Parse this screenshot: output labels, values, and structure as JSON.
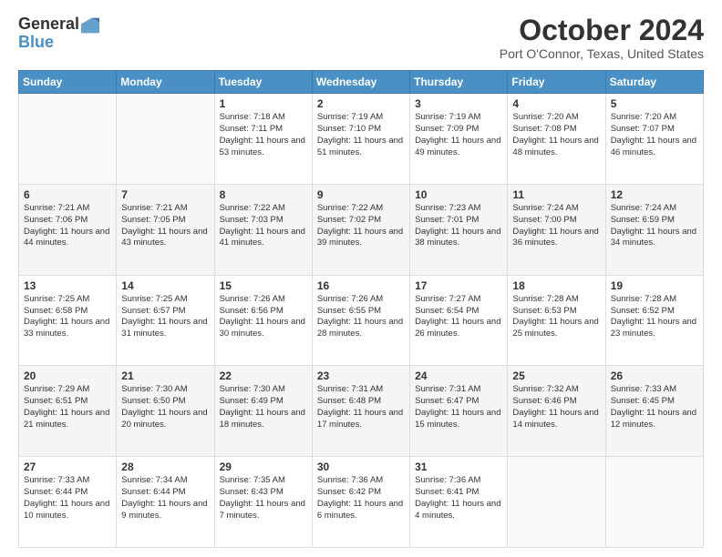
{
  "header": {
    "logo_line1": "General",
    "logo_line2": "Blue",
    "month_title": "October 2024",
    "location": "Port O'Connor, Texas, United States"
  },
  "weekdays": [
    "Sunday",
    "Monday",
    "Tuesday",
    "Wednesday",
    "Thursday",
    "Friday",
    "Saturday"
  ],
  "weeks": [
    [
      null,
      null,
      {
        "day": 1,
        "sunrise": "7:18 AM",
        "sunset": "7:11 PM",
        "daylight": "11 hours and 53 minutes."
      },
      {
        "day": 2,
        "sunrise": "7:19 AM",
        "sunset": "7:10 PM",
        "daylight": "11 hours and 51 minutes."
      },
      {
        "day": 3,
        "sunrise": "7:19 AM",
        "sunset": "7:09 PM",
        "daylight": "11 hours and 49 minutes."
      },
      {
        "day": 4,
        "sunrise": "7:20 AM",
        "sunset": "7:08 PM",
        "daylight": "11 hours and 48 minutes."
      },
      {
        "day": 5,
        "sunrise": "7:20 AM",
        "sunset": "7:07 PM",
        "daylight": "11 hours and 46 minutes."
      }
    ],
    [
      {
        "day": 6,
        "sunrise": "7:21 AM",
        "sunset": "7:06 PM",
        "daylight": "11 hours and 44 minutes."
      },
      {
        "day": 7,
        "sunrise": "7:21 AM",
        "sunset": "7:05 PM",
        "daylight": "11 hours and 43 minutes."
      },
      {
        "day": 8,
        "sunrise": "7:22 AM",
        "sunset": "7:03 PM",
        "daylight": "11 hours and 41 minutes."
      },
      {
        "day": 9,
        "sunrise": "7:22 AM",
        "sunset": "7:02 PM",
        "daylight": "11 hours and 39 minutes."
      },
      {
        "day": 10,
        "sunrise": "7:23 AM",
        "sunset": "7:01 PM",
        "daylight": "11 hours and 38 minutes."
      },
      {
        "day": 11,
        "sunrise": "7:24 AM",
        "sunset": "7:00 PM",
        "daylight": "11 hours and 36 minutes."
      },
      {
        "day": 12,
        "sunrise": "7:24 AM",
        "sunset": "6:59 PM",
        "daylight": "11 hours and 34 minutes."
      }
    ],
    [
      {
        "day": 13,
        "sunrise": "7:25 AM",
        "sunset": "6:58 PM",
        "daylight": "11 hours and 33 minutes."
      },
      {
        "day": 14,
        "sunrise": "7:25 AM",
        "sunset": "6:57 PM",
        "daylight": "11 hours and 31 minutes."
      },
      {
        "day": 15,
        "sunrise": "7:26 AM",
        "sunset": "6:56 PM",
        "daylight": "11 hours and 30 minutes."
      },
      {
        "day": 16,
        "sunrise": "7:26 AM",
        "sunset": "6:55 PM",
        "daylight": "11 hours and 28 minutes."
      },
      {
        "day": 17,
        "sunrise": "7:27 AM",
        "sunset": "6:54 PM",
        "daylight": "11 hours and 26 minutes."
      },
      {
        "day": 18,
        "sunrise": "7:28 AM",
        "sunset": "6:53 PM",
        "daylight": "11 hours and 25 minutes."
      },
      {
        "day": 19,
        "sunrise": "7:28 AM",
        "sunset": "6:52 PM",
        "daylight": "11 hours and 23 minutes."
      }
    ],
    [
      {
        "day": 20,
        "sunrise": "7:29 AM",
        "sunset": "6:51 PM",
        "daylight": "11 hours and 21 minutes."
      },
      {
        "day": 21,
        "sunrise": "7:30 AM",
        "sunset": "6:50 PM",
        "daylight": "11 hours and 20 minutes."
      },
      {
        "day": 22,
        "sunrise": "7:30 AM",
        "sunset": "6:49 PM",
        "daylight": "11 hours and 18 minutes."
      },
      {
        "day": 23,
        "sunrise": "7:31 AM",
        "sunset": "6:48 PM",
        "daylight": "11 hours and 17 minutes."
      },
      {
        "day": 24,
        "sunrise": "7:31 AM",
        "sunset": "6:47 PM",
        "daylight": "11 hours and 15 minutes."
      },
      {
        "day": 25,
        "sunrise": "7:32 AM",
        "sunset": "6:46 PM",
        "daylight": "11 hours and 14 minutes."
      },
      {
        "day": 26,
        "sunrise": "7:33 AM",
        "sunset": "6:45 PM",
        "daylight": "11 hours and 12 minutes."
      }
    ],
    [
      {
        "day": 27,
        "sunrise": "7:33 AM",
        "sunset": "6:44 PM",
        "daylight": "11 hours and 10 minutes."
      },
      {
        "day": 28,
        "sunrise": "7:34 AM",
        "sunset": "6:44 PM",
        "daylight": "11 hours and 9 minutes."
      },
      {
        "day": 29,
        "sunrise": "7:35 AM",
        "sunset": "6:43 PM",
        "daylight": "11 hours and 7 minutes."
      },
      {
        "day": 30,
        "sunrise": "7:36 AM",
        "sunset": "6:42 PM",
        "daylight": "11 hours and 6 minutes."
      },
      {
        "day": 31,
        "sunrise": "7:36 AM",
        "sunset": "6:41 PM",
        "daylight": "11 hours and 4 minutes."
      },
      null,
      null
    ]
  ]
}
